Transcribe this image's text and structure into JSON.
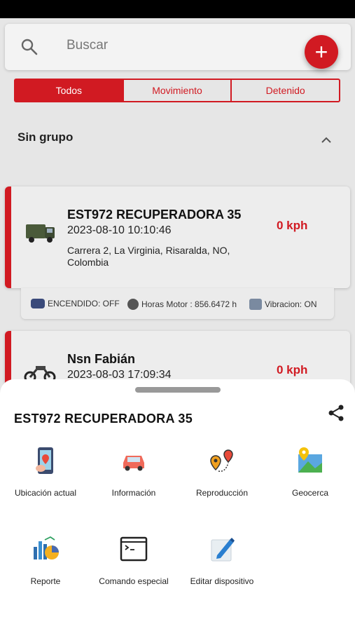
{
  "search": {
    "placeholder": "Buscar"
  },
  "fab_label": "+",
  "tabs": [
    "Todos",
    "Movimiento",
    "Detenido"
  ],
  "group": {
    "title": "Sin grupo"
  },
  "vehicles": [
    {
      "name": "EST972 RECUPERADORA  35",
      "datetime": "2023-08-10 10:10:46",
      "address": "Carrera 2, La Virginia, Risaralda, NO, Colombia",
      "speed": "0 kph",
      "icon": "truck-icon"
    },
    {
      "name": "Nsn Fabián",
      "datetime": "2023-08-03 17:09:34",
      "speed": "0 kph",
      "icon": "motorcycle-icon"
    }
  ],
  "status": {
    "ignition": "ENCENDIDO: OFF",
    "engine_hours": "Horas Motor : 856.6472 h",
    "vibration": "Vibracion: ON"
  },
  "sheet": {
    "title": "EST972 RECUPERADORA  35",
    "actions": [
      {
        "label": "Ubicación actual",
        "icon": "location-phone-icon"
      },
      {
        "label": "Información",
        "icon": "car-icon"
      },
      {
        "label": "Reproducción",
        "icon": "route-pins-icon"
      },
      {
        "label": "Geocerca",
        "icon": "map-pin-icon"
      },
      {
        "label": "Reporte",
        "icon": "report-chart-icon"
      },
      {
        "label": "Comando especial",
        "icon": "terminal-icon"
      },
      {
        "label": "Editar dispositivo",
        "icon": "edit-pencil-icon"
      }
    ]
  },
  "colors": {
    "accent": "#d11a22",
    "background": "#e6e6e6"
  }
}
